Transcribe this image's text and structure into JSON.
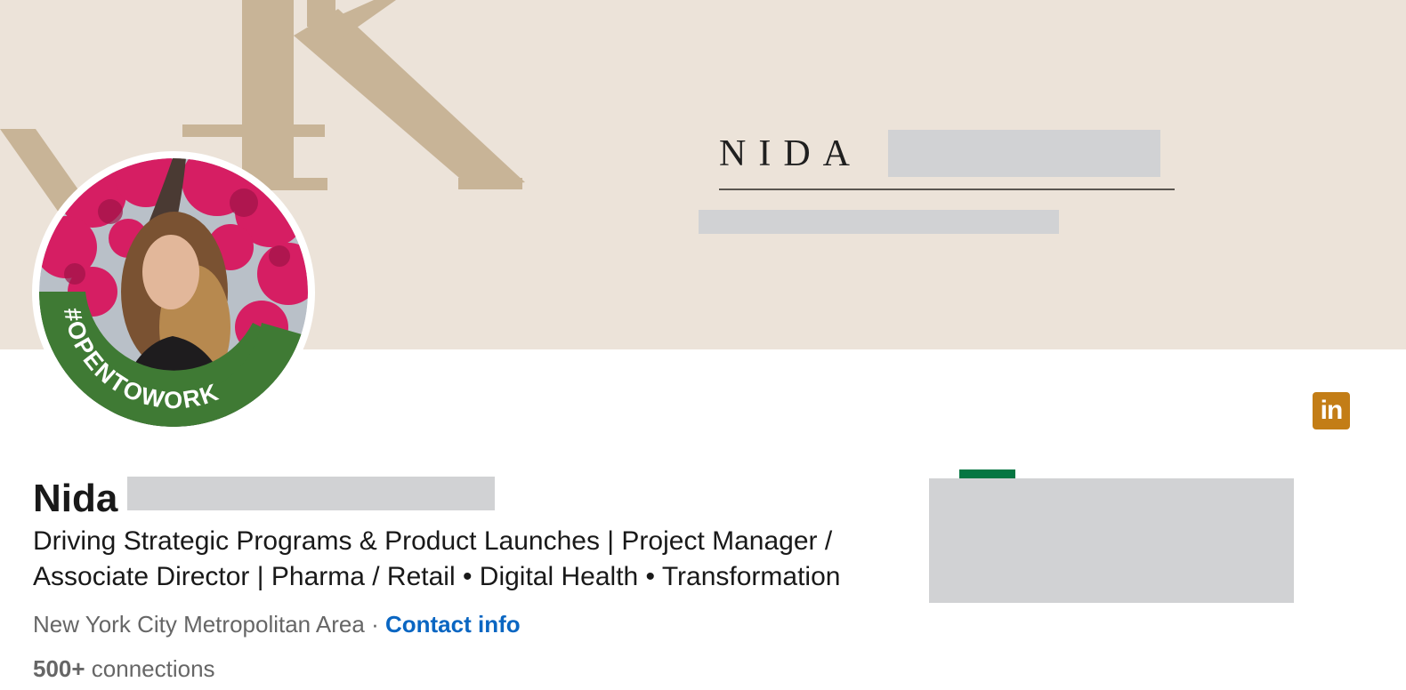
{
  "banner": {
    "name_text": "NIDA",
    "colors": {
      "background": "#ece3d9",
      "monogram": "#c8b497",
      "redaction": "#d1d2d4"
    }
  },
  "avatar": {
    "frame_text": "#OPENTOWORK",
    "frame_color": "#3f7a34"
  },
  "social_badge": {
    "icon": "linkedin-icon",
    "text": "in",
    "color": "#c37d16"
  },
  "profile": {
    "first_name": "Nida",
    "headline": "Driving Strategic Programs & Product Launches | Project Manager / Associate Director | Pharma / Retail • Digital Health • Transformation",
    "location": "New York City Metropolitan Area",
    "separator": " · ",
    "contact_label": "Contact info",
    "connections_count": "500+",
    "connections_label": " connections",
    "link_color": "#0a66c2"
  },
  "right_panel": {
    "accent_color": "#057642"
  }
}
